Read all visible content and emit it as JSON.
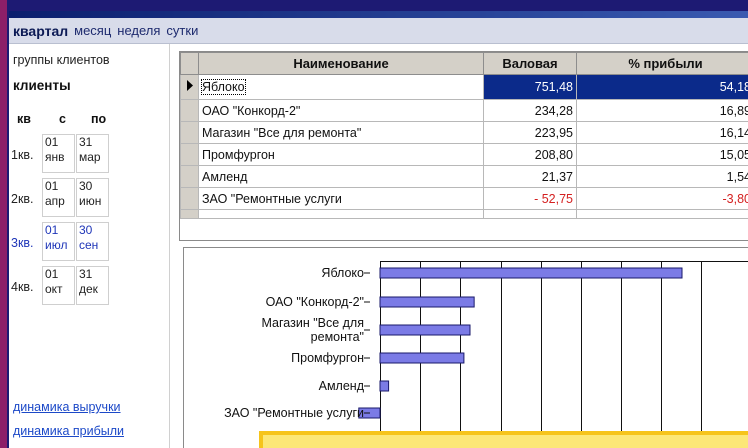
{
  "tabs": [
    "квартал",
    "месяц",
    "неделя",
    "сутки"
  ],
  "active_tab": 0,
  "left_panel": {
    "title": "группы клиентов",
    "header": "клиенты",
    "columns": [
      "кв",
      "с",
      "по"
    ],
    "quarters": [
      {
        "label": "1кв.",
        "from_day": "01",
        "from_month": "янв",
        "to_day": "31",
        "to_month": "мар"
      },
      {
        "label": "2кв.",
        "from_day": "01",
        "from_month": "апр",
        "to_day": "30",
        "to_month": "июн"
      },
      {
        "label": "3кв.",
        "from_day": "01",
        "from_month": "июл",
        "to_day": "30",
        "to_month": "сен"
      },
      {
        "label": "4кв.",
        "from_day": "01",
        "from_month": "окт",
        "to_day": "31",
        "to_month": "дек"
      }
    ],
    "selected_quarter": 2,
    "links": [
      "динамика выручки",
      "динамика прибыли"
    ]
  },
  "table": {
    "headers": [
      "Наименование",
      "Валовая",
      "% прибыли"
    ],
    "rows": [
      {
        "name": "Яблоко",
        "gross": "751,48",
        "profit": "54,18"
      },
      {
        "name": "ОАО \"Конкорд-2\"",
        "gross": "234,28",
        "profit": "16,89"
      },
      {
        "name": "Магазин \"Все для ремонта\"",
        "gross": "223,95",
        "profit": "16,14"
      },
      {
        "name": "Промфургон",
        "gross": "208,80",
        "profit": "15,05"
      },
      {
        "name": "Амленд",
        "gross": "21,37",
        "profit": "1,54"
      },
      {
        "name": "ЗАО \"Ремонтные услуги",
        "gross": "- 52,75",
        "profit": "-3,80"
      }
    ],
    "selected_row": 0
  },
  "chart_data": {
    "type": "bar",
    "orientation": "horizontal",
    "categories": [
      "Яблоко",
      "ОАО \"Конкорд-2\"",
      "Магазин \"Все для ремонта\"",
      "Промфургон",
      "Амленд",
      "ЗАО \"Ремонтные услуги"
    ],
    "category_label_lines": [
      [
        "Яблоко"
      ],
      [
        "ОАО \"Конкорд-2\""
      ],
      [
        "Магазин \"Все для",
        "ремонта\""
      ],
      [
        "Промфургон"
      ],
      [
        "Амленд"
      ],
      [
        "ЗАО \"Ремонтные услуги"
      ]
    ],
    "values": [
      751.48,
      234.28,
      223.95,
      208.8,
      21.37,
      -52.75
    ],
    "xlim": [
      -100,
      800
    ],
    "grid": true,
    "bar_color": "#7b7be6",
    "bar_edge": "#1a1a6a"
  },
  "colors": {
    "selected_row": "#0b2a8a",
    "link": "#1c49c8",
    "tooltip": "#fce777"
  }
}
